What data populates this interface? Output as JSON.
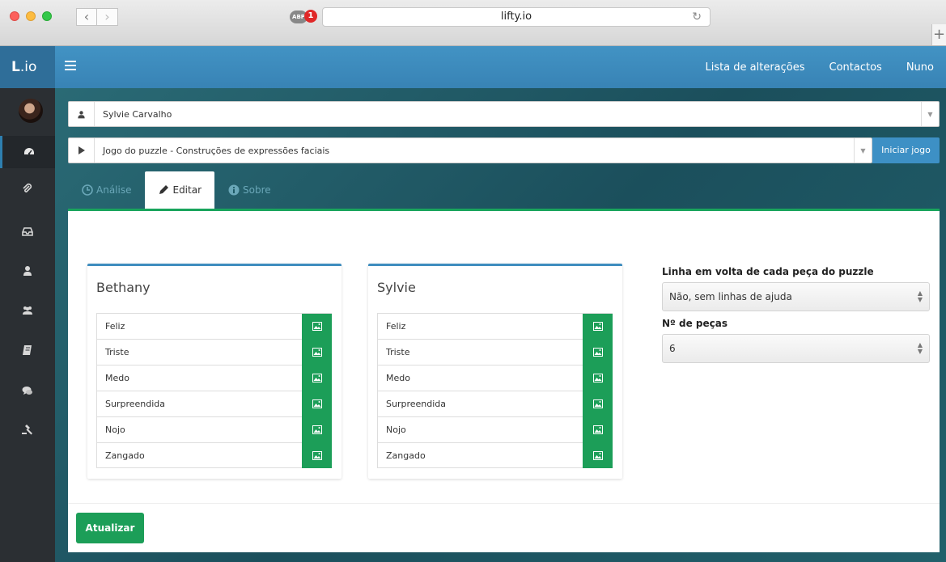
{
  "browser": {
    "url": "lifty.io",
    "adblock_label": "ABP",
    "adblock_count": "1",
    "back_glyph": "‹",
    "forward_glyph": "›",
    "reload_glyph": "↻",
    "newtab_glyph": "+"
  },
  "app": {
    "brand_bold": "L",
    "brand_rest": ".io",
    "menu_icon": "hamburger-icon",
    "nav": [
      "Lista de alterações",
      "Contactos",
      "Nuno"
    ]
  },
  "sidebar": {
    "icons": [
      "dashboard-icon",
      "paperclip-icon",
      "inbox-icon",
      "user-icon",
      "users-icon",
      "book-icon",
      "comments-icon",
      "gavel-icon"
    ],
    "active_index": 0
  },
  "selectors": {
    "user": {
      "icon": "user-icon",
      "value": "Sylvie Carvalho"
    },
    "game": {
      "icon": "play-icon",
      "value": "Jogo do puzzle - Construções de expressões faciais",
      "start_label": "Iniciar jogo"
    }
  },
  "tabs": [
    {
      "label": "Análise",
      "icon": "clock-icon",
      "active": false
    },
    {
      "label": "Editar",
      "icon": "pencil-icon",
      "active": true
    },
    {
      "label": "Sobre",
      "icon": "info-icon",
      "active": false
    }
  ],
  "panels": [
    {
      "title": "Bethany",
      "items": [
        "Feliz",
        "Triste",
        "Medo",
        "Surpreendida",
        "Nojo",
        "Zangado"
      ]
    },
    {
      "title": "Sylvie",
      "items": [
        "Feliz",
        "Triste",
        "Medo",
        "Surpreendida",
        "Nojo",
        "Zangado"
      ]
    }
  ],
  "settings": {
    "outline_label": "Linha em volta de cada peça do puzzle",
    "outline_value": "Não, sem linhas de ajuda",
    "pieces_label": "Nº de peças",
    "pieces_value": "6"
  },
  "actions": {
    "update_label": "Atualizar"
  },
  "colors": {
    "accent_blue": "#3d90c5",
    "success_green": "#1c9e58",
    "tab_underline": "#19a55c",
    "sidebar": "#2b2f33"
  }
}
